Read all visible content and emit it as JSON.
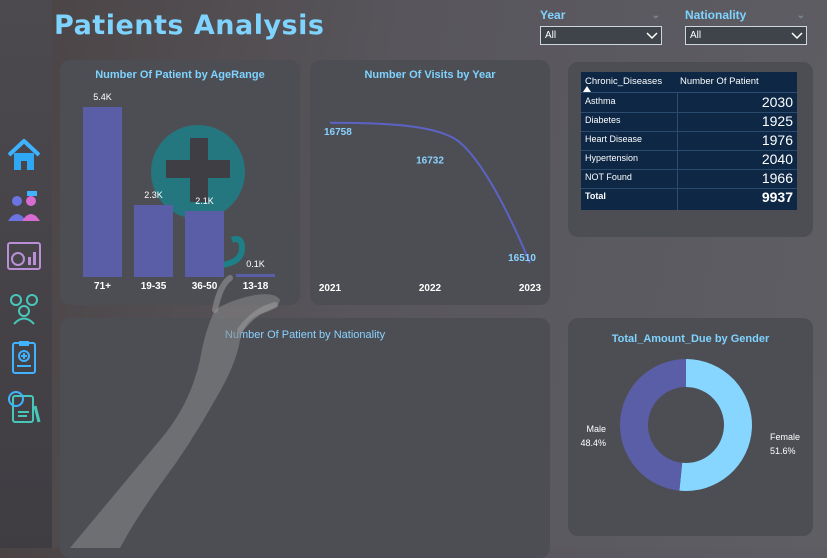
{
  "title": "Patients Analysis",
  "slicers": {
    "year": {
      "label": "Year",
      "value": "All"
    },
    "nationality": {
      "label": "Nationality",
      "value": "All"
    }
  },
  "nav": [
    "home-icon",
    "patients-icon",
    "dashboard-icon",
    "group-icon",
    "medical-report-icon",
    "billing-icon"
  ],
  "colors": {
    "accent": "#7fd3ff",
    "bar": "#5a5ea6",
    "female": "#86d6ff",
    "male": "#5a5ea6",
    "table_bg": "#0d2745"
  },
  "age_chart": {
    "title": "Number Of Patient by AgeRange",
    "chart_data": {
      "type": "bar",
      "categories": [
        "71+",
        "19-35",
        "36-50",
        "13-18"
      ],
      "values": [
        5.4,
        2.3,
        2.1,
        0.1
      ],
      "value_labels": [
        "5.4K",
        "2.3K",
        "2.1K",
        "0.1K"
      ],
      "unit": "K"
    }
  },
  "visits_chart": {
    "title": "Number Of Visits by Year",
    "chart_data": {
      "type": "line",
      "x": [
        "2021",
        "2022",
        "2023"
      ],
      "values": [
        16758,
        16732,
        16510
      ],
      "value_labels": [
        "16758",
        "16732",
        "16510"
      ]
    }
  },
  "table": {
    "headers": [
      "Chronic_Diseases",
      "Number Of Patient"
    ],
    "rows": [
      {
        "name": "Asthma",
        "value": "2030"
      },
      {
        "name": "Diabetes",
        "value": "1925"
      },
      {
        "name": "Heart Disease",
        "value": "1976"
      },
      {
        "name": "Hypertension",
        "value": "2040"
      },
      {
        "name": "NOT Found",
        "value": "1966"
      }
    ],
    "total": {
      "name": "Total",
      "value": "9937"
    }
  },
  "nationality_chart": {
    "title": "Number Of Patient by Nationality"
  },
  "gender_chart": {
    "title": "Total_Amount_Due by Gender",
    "chart_data": {
      "type": "pie",
      "categories": [
        "Male",
        "Female"
      ],
      "values": [
        48.4,
        51.6
      ],
      "value_labels": [
        "48.4%",
        "51.6%"
      ]
    }
  }
}
